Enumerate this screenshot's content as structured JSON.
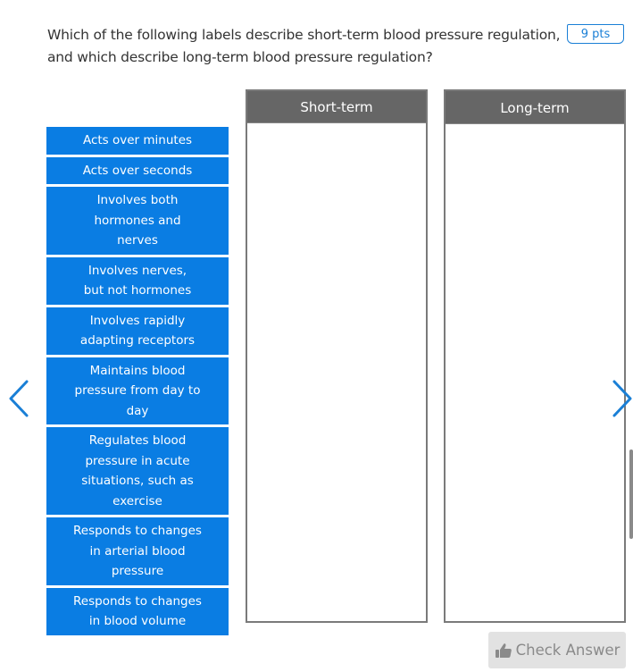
{
  "question": {
    "text": "Which of the following labels describe short-term blood pressure regulation, and which describe long-term blood pressure regulation?",
    "points": "9 pts"
  },
  "labels": [
    {
      "text": "Acts over minutes"
    },
    {
      "text": "Acts over seconds"
    },
    {
      "text": "Involves both hormones and nerves"
    },
    {
      "text": "Involves nerves, but not hormones"
    },
    {
      "text": "Involves rapidly adapting receptors"
    },
    {
      "text": "Maintains blood pressure from day to day"
    },
    {
      "text": "Regulates blood pressure in acute situations, such as exercise"
    },
    {
      "text": "Responds to changes in arterial blood pressure"
    },
    {
      "text": "Responds to changes in blood volume"
    }
  ],
  "bins": [
    {
      "title": "Short-term",
      "items": []
    },
    {
      "title": "Long-term",
      "items": []
    }
  ],
  "navigation": {
    "prev_icon": "chevron-left-icon",
    "next_icon": "chevron-right-icon"
  },
  "actions": {
    "check_answer_label": "Check Answer",
    "check_answer_icon": "thumbs-up-icon",
    "check_answer_enabled": false
  },
  "colors": {
    "accent": "#0a7de3",
    "bin_header": "#666666",
    "button_disabled_bg": "#e2e2e2",
    "button_disabled_text": "#8a8a8a"
  }
}
